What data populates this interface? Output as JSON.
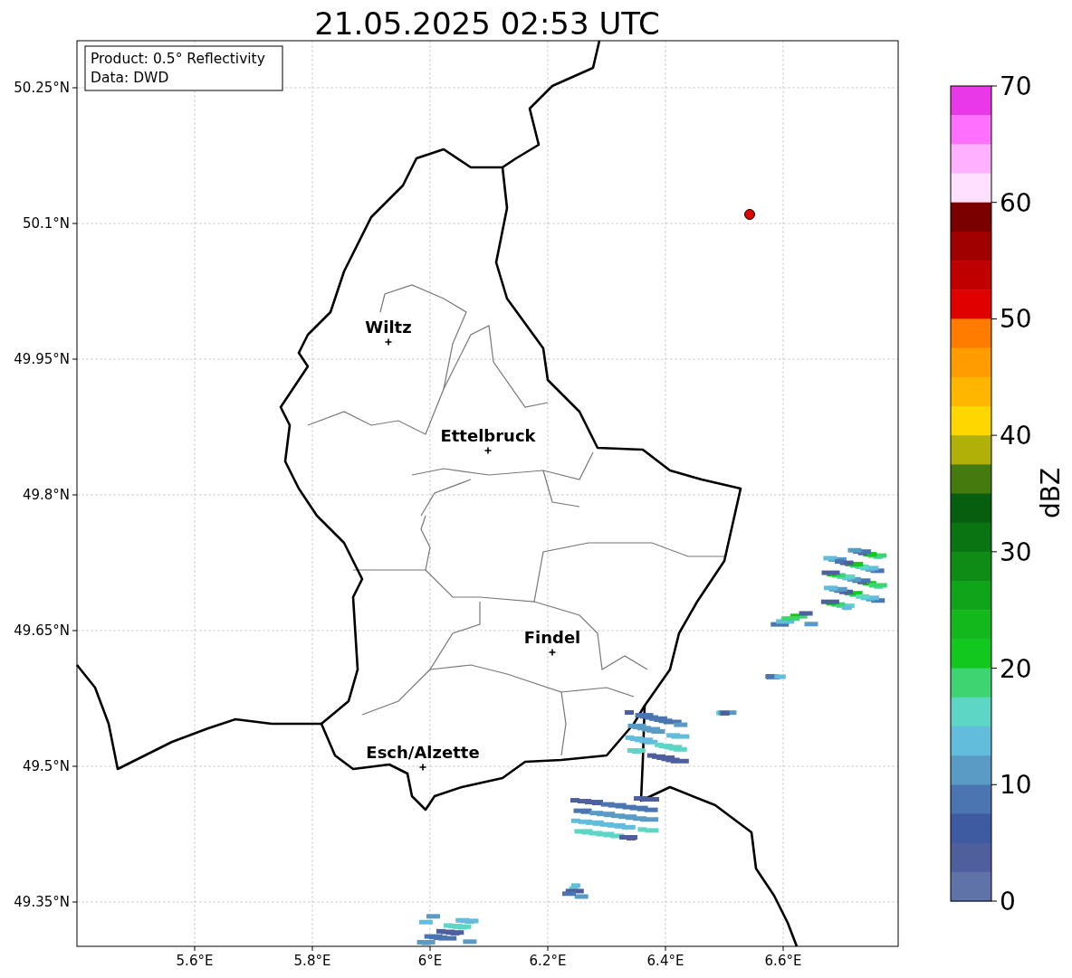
{
  "title": "21.05.2025 02:53 UTC",
  "info_box": [
    "Product: 0.5° Reflectivity",
    "Data: DWD"
  ],
  "y_ticks": [
    "50.25°N",
    "50.1°N",
    "49.95°N",
    "49.8°N",
    "49.65°N",
    "49.5°N",
    "49.35°N"
  ],
  "x_ticks": [
    "5.6°E",
    "5.8°E",
    "6°E",
    "6.2°E",
    "6.4°E",
    "6.6°E"
  ],
  "cities": [
    {
      "label": "Wiltz"
    },
    {
      "label": "Ettelbruck"
    },
    {
      "label": "Findel"
    },
    {
      "label": "Esch/Alzette"
    }
  ],
  "colorbar": {
    "label": "dBZ",
    "ticks": [
      "70",
      "60",
      "50",
      "40",
      "30",
      "20",
      "10",
      "0"
    ],
    "bins": [
      {
        "color": "#e838e8"
      },
      {
        "color": "#ff70ff"
      },
      {
        "color": "#ffb0ff"
      },
      {
        "color": "#ffe0ff"
      },
      {
        "color": "#7a0000"
      },
      {
        "color": "#a00000"
      },
      {
        "color": "#c00000"
      },
      {
        "color": "#e00000"
      },
      {
        "color": "#ff7c00"
      },
      {
        "color": "#ff9c00"
      },
      {
        "color": "#ffb600"
      },
      {
        "color": "#ffd700"
      },
      {
        "color": "#b0b008"
      },
      {
        "color": "#447a0e"
      },
      {
        "color": "#075e0e"
      },
      {
        "color": "#0a7412"
      },
      {
        "color": "#0e8c16"
      },
      {
        "color": "#10a41a"
      },
      {
        "color": "#12b81c"
      },
      {
        "color": "#12c81e"
      },
      {
        "color": "#3fd472"
      },
      {
        "color": "#5dd6c6"
      },
      {
        "color": "#62bcdc"
      },
      {
        "color": "#5a9bc5"
      },
      {
        "color": "#4a75b0"
      },
      {
        "color": "#3e5aa0"
      },
      {
        "color": "#4f5f9e"
      },
      {
        "color": "#5f73a8"
      }
    ]
  }
}
